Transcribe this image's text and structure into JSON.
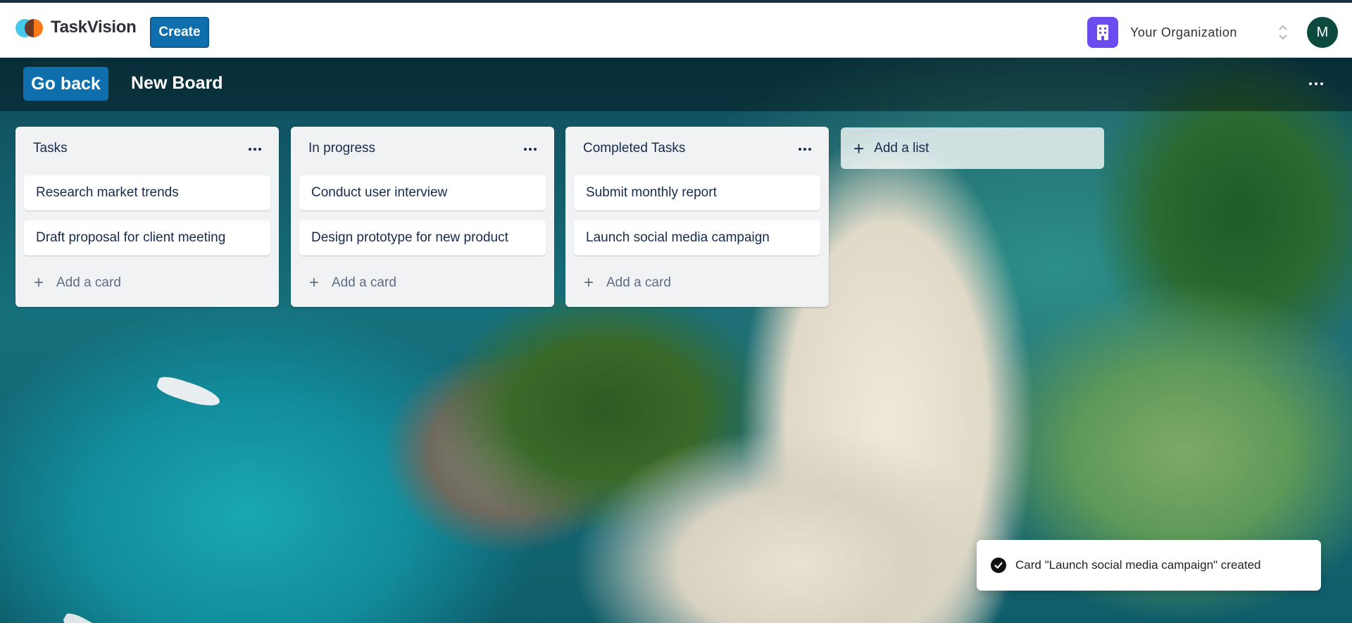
{
  "app": {
    "name": "TaskVision",
    "create_label": "Create",
    "organization": "Your Organization",
    "avatar_initial": "M"
  },
  "board": {
    "back_label": "Go back",
    "title": "New Board"
  },
  "lists": [
    {
      "title": "Tasks",
      "cards": [
        "Research market trends",
        "Draft proposal for client meeting"
      ],
      "add_card_label": "Add a card"
    },
    {
      "title": "In progress",
      "cards": [
        "Conduct user interview",
        "Design prototype for new product"
      ],
      "add_card_label": "Add a card"
    },
    {
      "title": "Completed Tasks",
      "cards": [
        "Submit monthly report",
        "Launch social media campaign"
      ],
      "add_card_label": "Add a card"
    }
  ],
  "add_list_label": "Add a list",
  "toast": {
    "message": "Card \"Launch social media campaign\" created"
  },
  "colors": {
    "primary": "#0f6fad",
    "org_icon": "#6c4cf1",
    "avatar": "#0b4a3c"
  },
  "icons": {
    "logo": "logo-icon",
    "org": "building-icon",
    "org_switch": "chevron-up-down-icon",
    "board_menu": "more-horizontal-icon",
    "list_menu": "more-horizontal-icon",
    "add": "plus-icon",
    "toast": "check-circle-icon"
  }
}
